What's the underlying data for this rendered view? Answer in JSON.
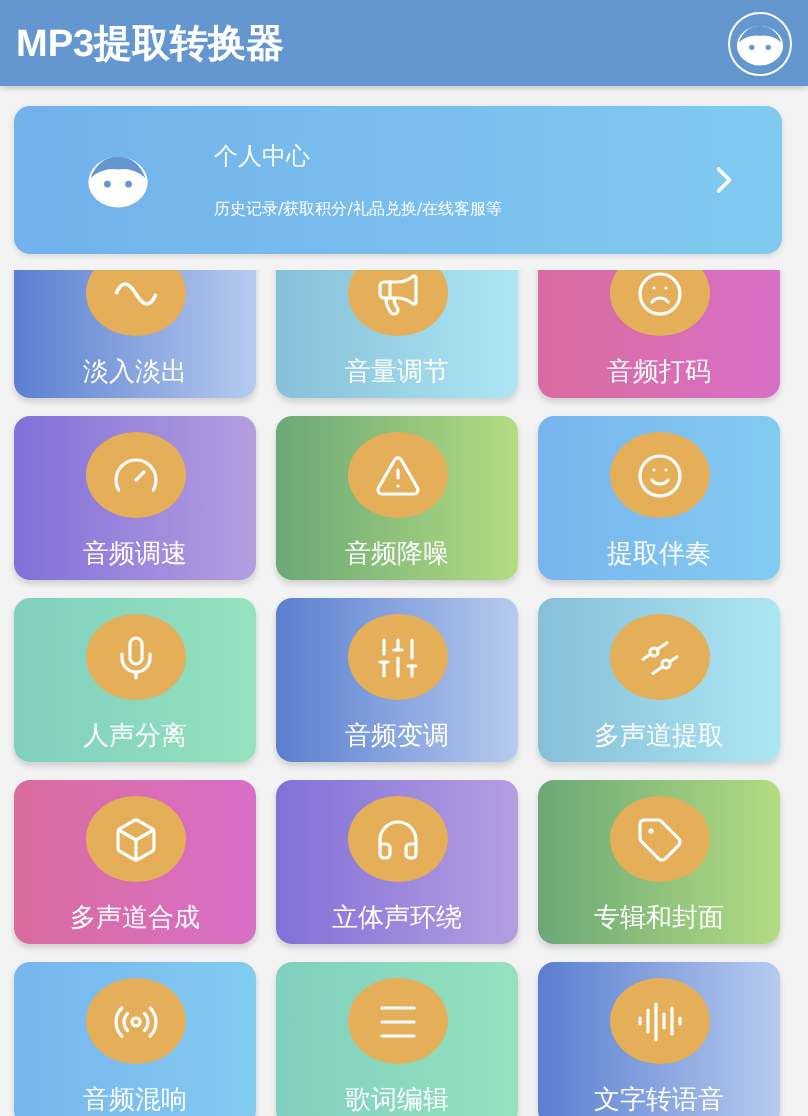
{
  "header": {
    "title": "MP3提取转换器"
  },
  "profile_card": {
    "title": "个人中心",
    "subtitle": "历史记录/获取积分/礼品兑换/在线客服等"
  },
  "tools": [
    {
      "label": "淡入淡出",
      "kind": "blue"
    },
    {
      "label": "音量调节",
      "kind": "sky"
    },
    {
      "label": "音频打码",
      "kind": "pink"
    },
    {
      "label": "音频调速",
      "kind": "purple"
    },
    {
      "label": "音频降噪",
      "kind": "green"
    },
    {
      "label": "提取伴奏",
      "kind": "azure"
    },
    {
      "label": "人声分离",
      "kind": "mint"
    },
    {
      "label": "音频变调",
      "kind": "blue"
    },
    {
      "label": "多声道提取",
      "kind": "sky"
    },
    {
      "label": "多声道合成",
      "kind": "pink"
    },
    {
      "label": "立体声环绕",
      "kind": "purple"
    },
    {
      "label": "专辑和封面",
      "kind": "green"
    },
    {
      "label": "音频混响",
      "kind": "azure"
    },
    {
      "label": "歌词编辑",
      "kind": "mint"
    },
    {
      "label": "文字转语音",
      "kind": "blue"
    }
  ]
}
